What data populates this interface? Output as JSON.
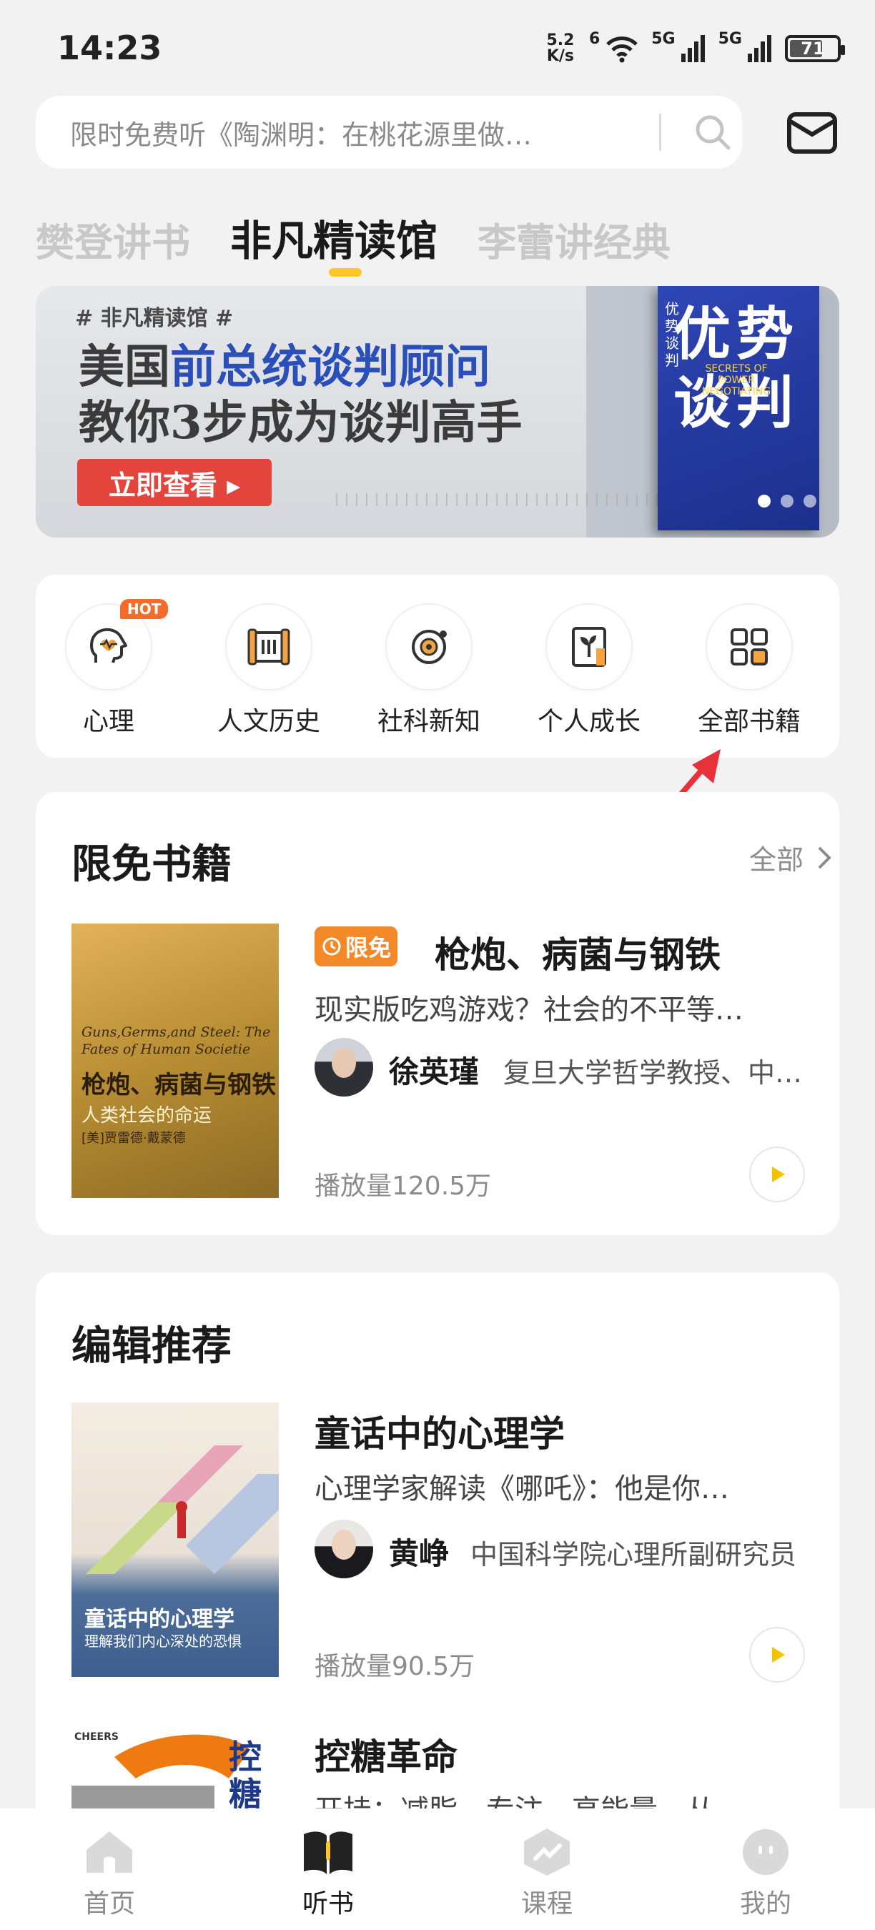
{
  "status_bar": {
    "time": "14:23",
    "net_speed_value": "5.2",
    "net_speed_unit": "K/s",
    "wifi_label": "6",
    "sim1_label": "5G",
    "sim2_label": "5G",
    "battery": "71"
  },
  "search": {
    "placeholder": "限时免费听《陶渊明：在桃花源里做…"
  },
  "tabs": [
    {
      "label": "樊登讲书",
      "active": false
    },
    {
      "label": "非凡精读馆",
      "active": true
    },
    {
      "label": "李蕾讲经典",
      "active": false
    }
  ],
  "banner": {
    "tag": "# 非凡精读馆 #",
    "line1_a": "美国",
    "line1_b": "前总统谈判顾问",
    "line2": "教你3步成为谈判高手",
    "button": "立即查看 ▸",
    "book_title": "优势谈判",
    "book_vertical": "优势谈判",
    "book_subtitle": "SECRETS OF POWER NEGOTIATING",
    "active_dot": 0
  },
  "categories": [
    {
      "label": "心理",
      "icon": "head-heart-icon",
      "badge": "HOT"
    },
    {
      "label": "人文历史",
      "icon": "scroll-icon"
    },
    {
      "label": "社科新知",
      "icon": "orbit-icon"
    },
    {
      "label": "个人成长",
      "icon": "sprout-book-icon"
    },
    {
      "label": "全部书籍",
      "icon": "grid-icon"
    }
  ],
  "free_books": {
    "title": "限免书籍",
    "all_label": "全部",
    "badge": "限免",
    "book": {
      "title": "枪炮、病菌与钢铁",
      "description": "现实版吃鸡游戏？社会的不平等…",
      "author": "徐英瑾",
      "author_title": "复旦大学哲学教授、中…",
      "plays": "播放量120.5万",
      "cover_en": "Guns,Germs,and Steel: The Fates of Human Societie",
      "cover_cn": "枪炮、病菌与钢铁",
      "cover_sub": "人类社会的命运",
      "cover_author": "[美]贾雷德·戴蒙德"
    }
  },
  "editor_picks": {
    "title": "编辑推荐",
    "books": [
      {
        "title": "童话中的心理学",
        "description": "心理学家解读《哪吒》：他是你…",
        "author": "黄峥",
        "author_title": "中国科学院心理所副研究员",
        "plays": "播放量90.5万",
        "cover_title": "童话中的心理学",
        "cover_sub": "理解我们内心深处的恐惧"
      },
      {
        "title": "控糖革命",
        "description": "开挂：减脂、专注、高能量、从…",
        "cover_title": "控糖"
      }
    ]
  },
  "bottom_nav": [
    {
      "label": "首页",
      "icon": "home-icon",
      "active": false
    },
    {
      "label": "听书",
      "icon": "open-book-icon",
      "active": true
    },
    {
      "label": "课程",
      "icon": "course-icon",
      "active": false
    },
    {
      "label": "我的",
      "icon": "profile-icon",
      "active": false
    }
  ],
  "colors": {
    "accent_yellow": "#ffc629",
    "free_badge": "#f4892a",
    "banner_button": "#e3443c",
    "arrow": "#e8323b"
  }
}
